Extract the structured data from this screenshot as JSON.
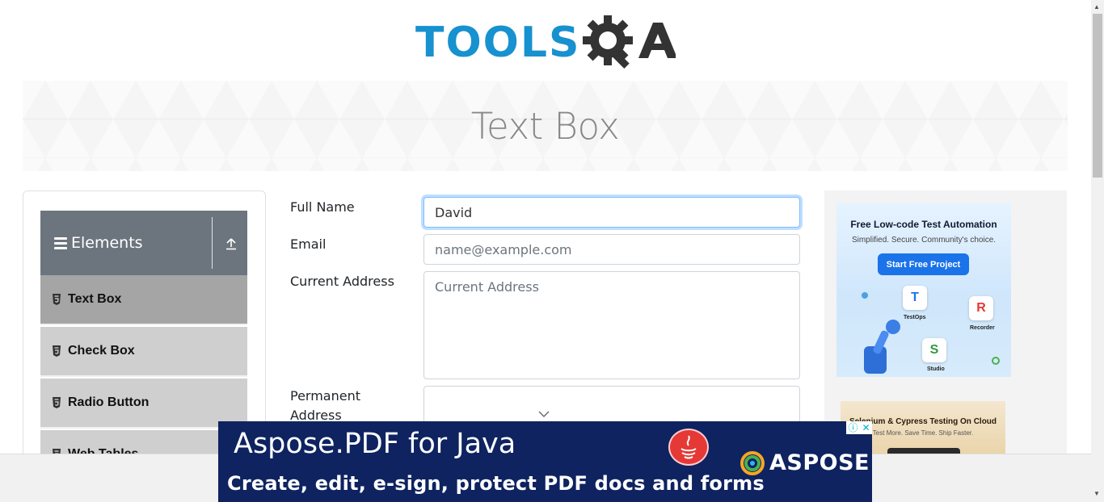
{
  "logo": {
    "text": "TOOLS",
    "icon": "qa-gear-logo-icon"
  },
  "banner": {
    "title": "Text Box"
  },
  "sidebar": {
    "group_title": "Elements",
    "items": [
      {
        "label": "Text Box",
        "active": true
      },
      {
        "label": "Check Box",
        "active": false
      },
      {
        "label": "Radio Button",
        "active": false
      },
      {
        "label": "Web Tables",
        "active": false
      }
    ]
  },
  "form": {
    "full_name_label": "Full Name",
    "full_name_value": "David",
    "email_label": "Email",
    "email_placeholder": "name@example.com",
    "current_address_label": "Current Address",
    "current_address_placeholder": "Current Address",
    "permanent_address_label_1": "Permanent",
    "permanent_address_label_2": "Address"
  },
  "ad_right_1": {
    "title": "Free Low-code Test Automation",
    "subtitle": "Simplified. Secure. Community's choice.",
    "button": "Start Free Project",
    "tile_labels": [
      "TestOps",
      "Recorder",
      "Studio"
    ]
  },
  "ad_right_2": {
    "title": "Selenium & Cypress Testing On Cloud",
    "subtitle": "Test More. Save Time. Ship Faster."
  },
  "bottom_ad": {
    "line1": "Aspose.PDF for Java",
    "line2": "Create, edit, e-sign, protect PDF docs and forms",
    "brand": "ASPOSE"
  },
  "colors": {
    "brand_blue": "#1791cf",
    "sidebar_header": "#6c757d",
    "ad_navy": "#0e2360"
  }
}
